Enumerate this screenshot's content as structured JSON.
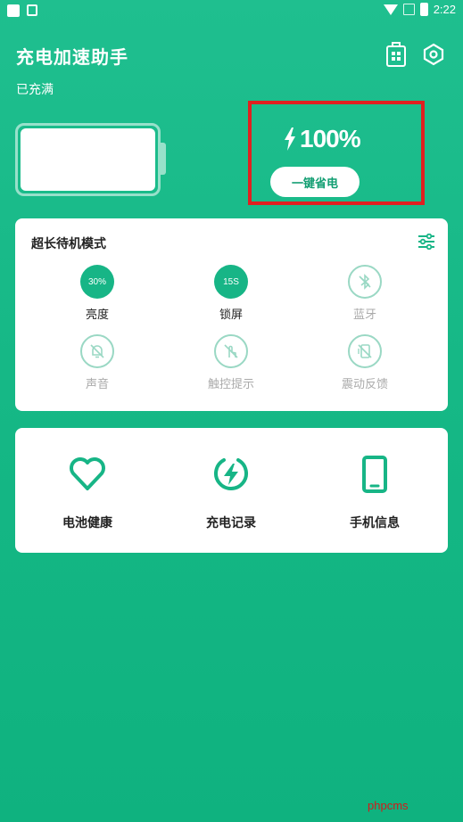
{
  "status_bar": {
    "time": "2:22"
  },
  "header": {
    "title": "充电加速助手",
    "status": "已充满"
  },
  "charge": {
    "percent": "100%",
    "button": "一键省电"
  },
  "mode": {
    "title": "超长待机模式",
    "options": [
      {
        "label": "亮度",
        "value": "30%",
        "active": true
      },
      {
        "label": "锁屏",
        "value": "15S",
        "active": true
      },
      {
        "label": "蓝牙",
        "active": false
      },
      {
        "label": "声音",
        "active": false
      },
      {
        "label": "触控提示",
        "active": false
      },
      {
        "label": "震动反馈",
        "active": false
      }
    ]
  },
  "tools": [
    {
      "label": "电池健康"
    },
    {
      "label": "充电记录"
    },
    {
      "label": "手机信息"
    }
  ],
  "watermark": "phpcms",
  "colors": {
    "accent": "#17b586",
    "highlight": "#e02020"
  }
}
